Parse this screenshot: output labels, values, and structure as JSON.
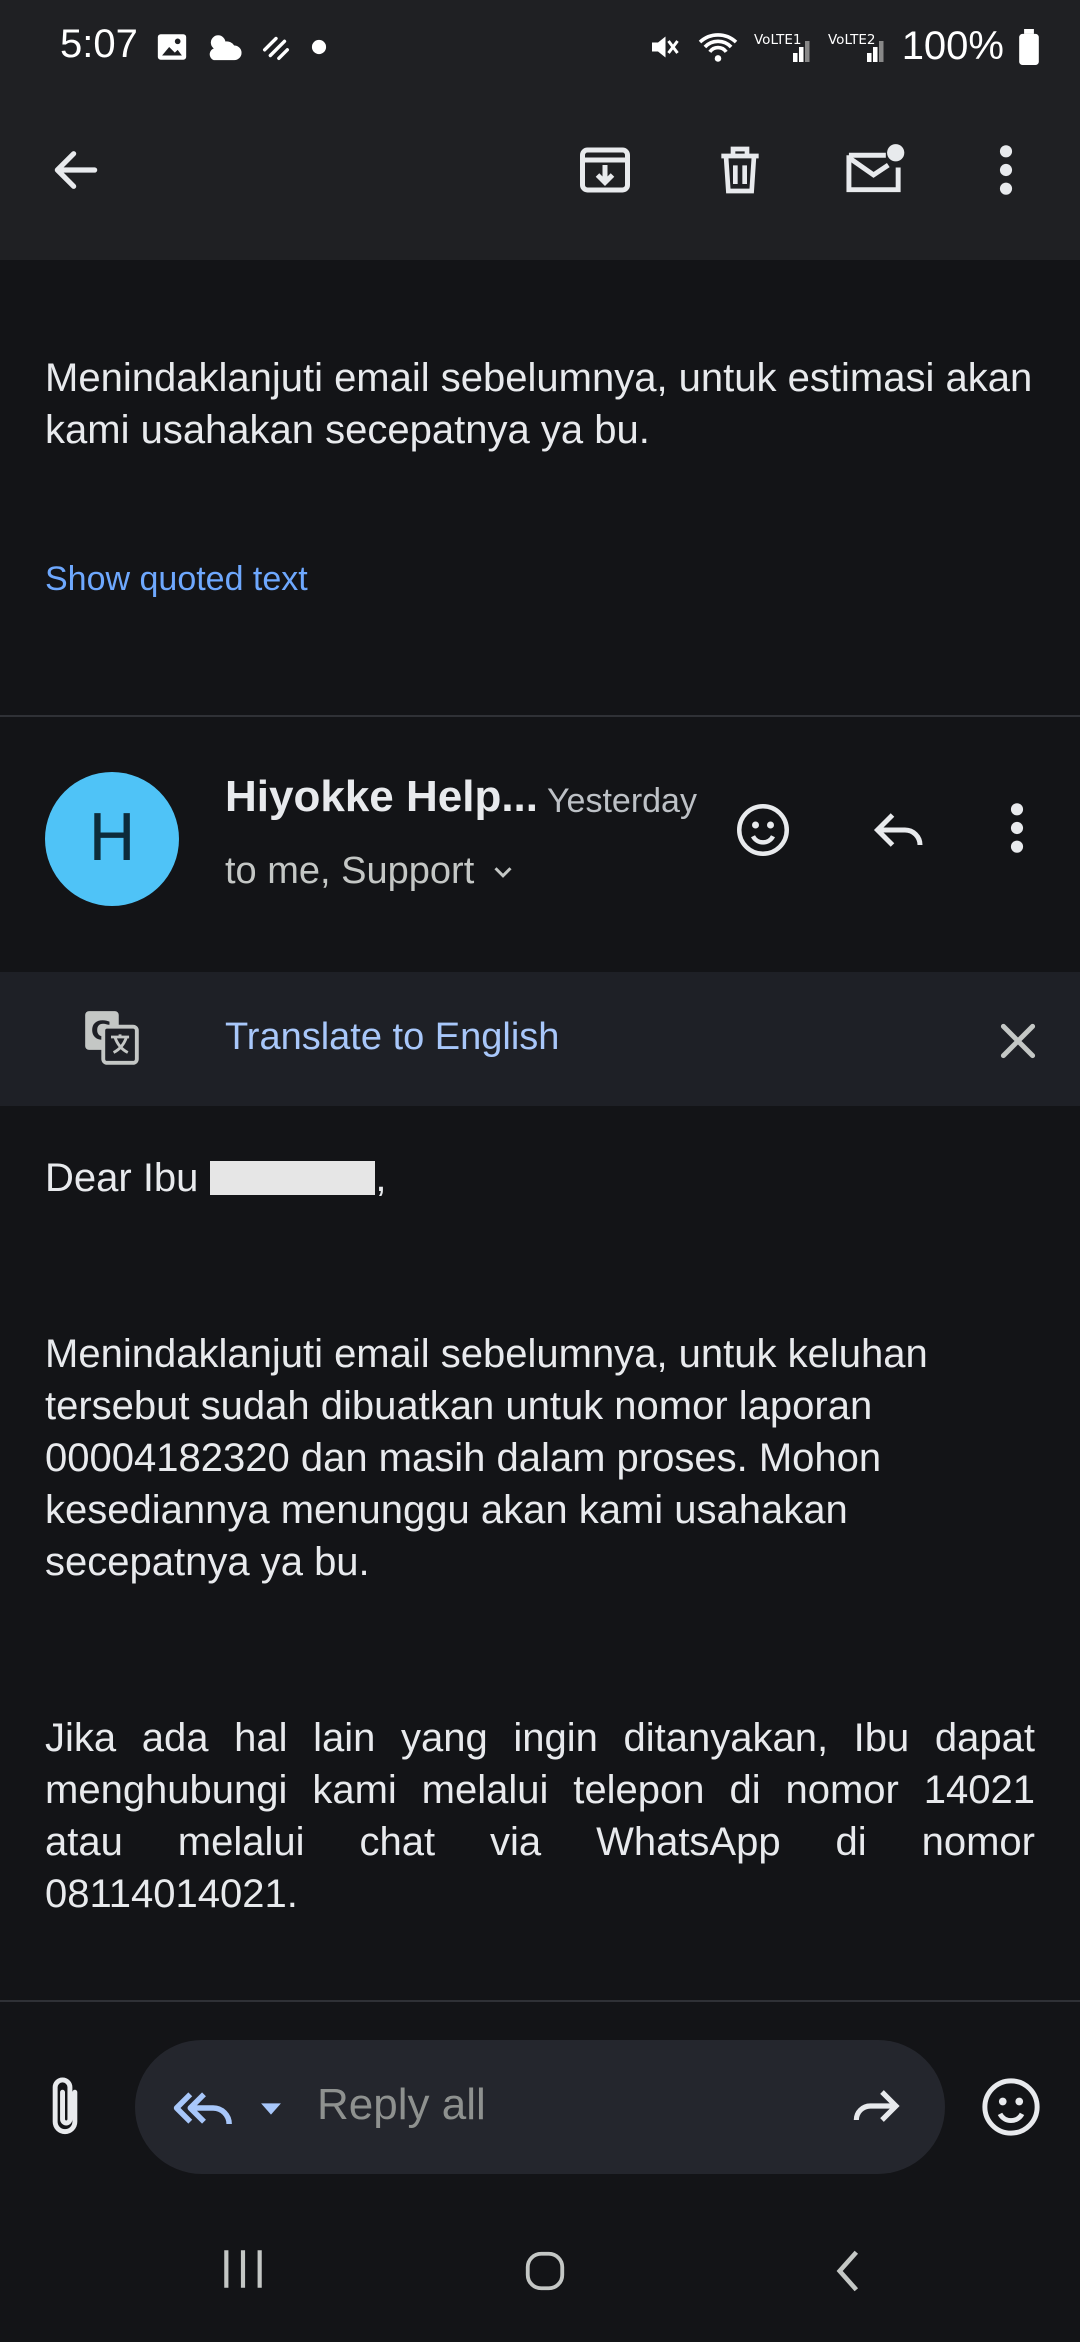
{
  "status_bar": {
    "time": "5:07",
    "battery": "100%"
  },
  "toolbar": {
    "back": "back-arrow-icon",
    "archive": "archive-icon",
    "delete": "delete-icon",
    "mark_unread": "mark-unread-icon",
    "more": "more-vertical-icon"
  },
  "previous_message": {
    "text": "Menindaklanjuti email sebelumnya, untuk estimasi akan kami usahakan secepatnya ya bu.",
    "show_quoted": "Show quoted text"
  },
  "message": {
    "avatar_letter": "H",
    "sender": "Hiyokke Help...",
    "time": "Yesterday",
    "recipients": "to me, Support",
    "translate": "Translate to English",
    "greeting": "Dear Ibu",
    "greeting_suffix": ",",
    "paragraph1": "Menindaklanjuti email sebelumnya, untuk keluhan tersebut sudah dibuatkan untuk nomor laporan 00004182320 dan masih dalam proses. Mohon kesediannya menunggu akan kami usahakan secepatnya ya bu.",
    "paragraph2": "Jika ada hal lain yang ingin ditanyakan, Ibu dapat menghubungi kami melalui telepon di nomor 14021 atau melalui chat via WhatsApp di nomor 08114014021."
  },
  "reply_bar": {
    "placeholder": "Reply all"
  },
  "colors": {
    "background": "#131417",
    "avatar": "#4fc3f7",
    "link": "#6ea8fe",
    "translate": "#a8c7fa"
  }
}
